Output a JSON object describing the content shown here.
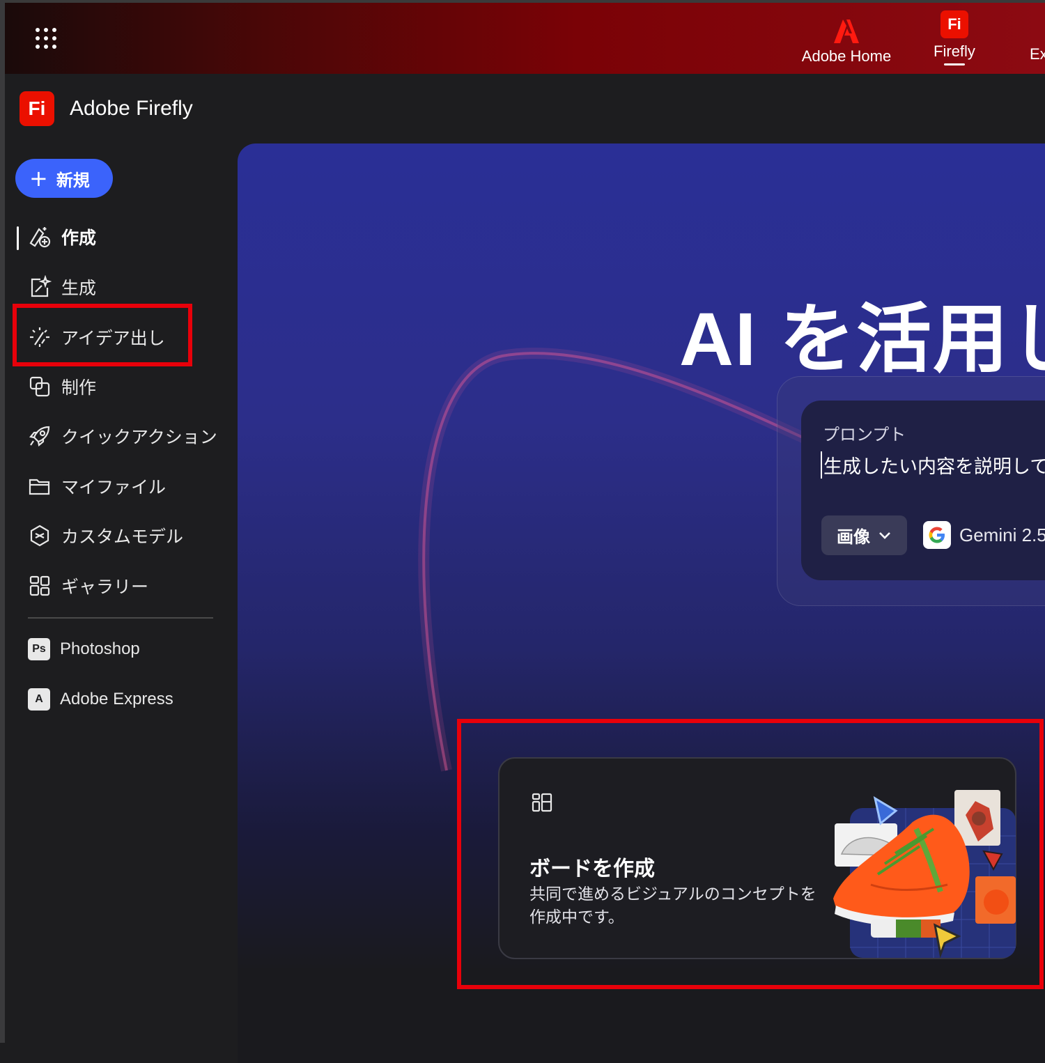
{
  "topbar": {
    "nav": [
      {
        "label": "Adobe Home",
        "icon": "adobe-logo-icon"
      },
      {
        "label": "Firefly",
        "icon": "firefly-logo-icon",
        "active": true
      },
      {
        "label": "Ex"
      }
    ],
    "firefly_badge": "Fi"
  },
  "brand": {
    "logo_text": "Fi",
    "title": "Adobe Firefly"
  },
  "sidebar": {
    "new_label": "新規",
    "items": [
      {
        "label": "作成",
        "icon": "create-icon",
        "active": true
      },
      {
        "label": "生成",
        "icon": "generate-icon"
      },
      {
        "label": "アイデア出し",
        "icon": "ideation-icon"
      },
      {
        "label": "制作",
        "icon": "production-icon"
      },
      {
        "label": "クイックアクション",
        "icon": "rocket-icon"
      },
      {
        "label": "マイファイル",
        "icon": "folder-icon"
      },
      {
        "label": "カスタムモデル",
        "icon": "custom-model-icon"
      },
      {
        "label": "ギャラリー",
        "icon": "gallery-icon"
      }
    ],
    "apps": [
      {
        "label": "Photoshop",
        "badge": "Ps"
      },
      {
        "label": "Adobe Express",
        "badge": "A"
      }
    ]
  },
  "hero": {
    "headline": "AI を活用し",
    "prompt": {
      "label": "プロンプト",
      "text": "生成したい内容を説明して",
      "type_select": "画像",
      "model": "Gemini 2.5"
    }
  },
  "board_card": {
    "title": "ボードを作成",
    "description": "共同で進めるビジュアルのコンセプトを作成中です。"
  },
  "colors": {
    "accent_blue": "#3b63fb",
    "highlight_red": "#e8000a",
    "firefly_red": "#eb1000"
  }
}
